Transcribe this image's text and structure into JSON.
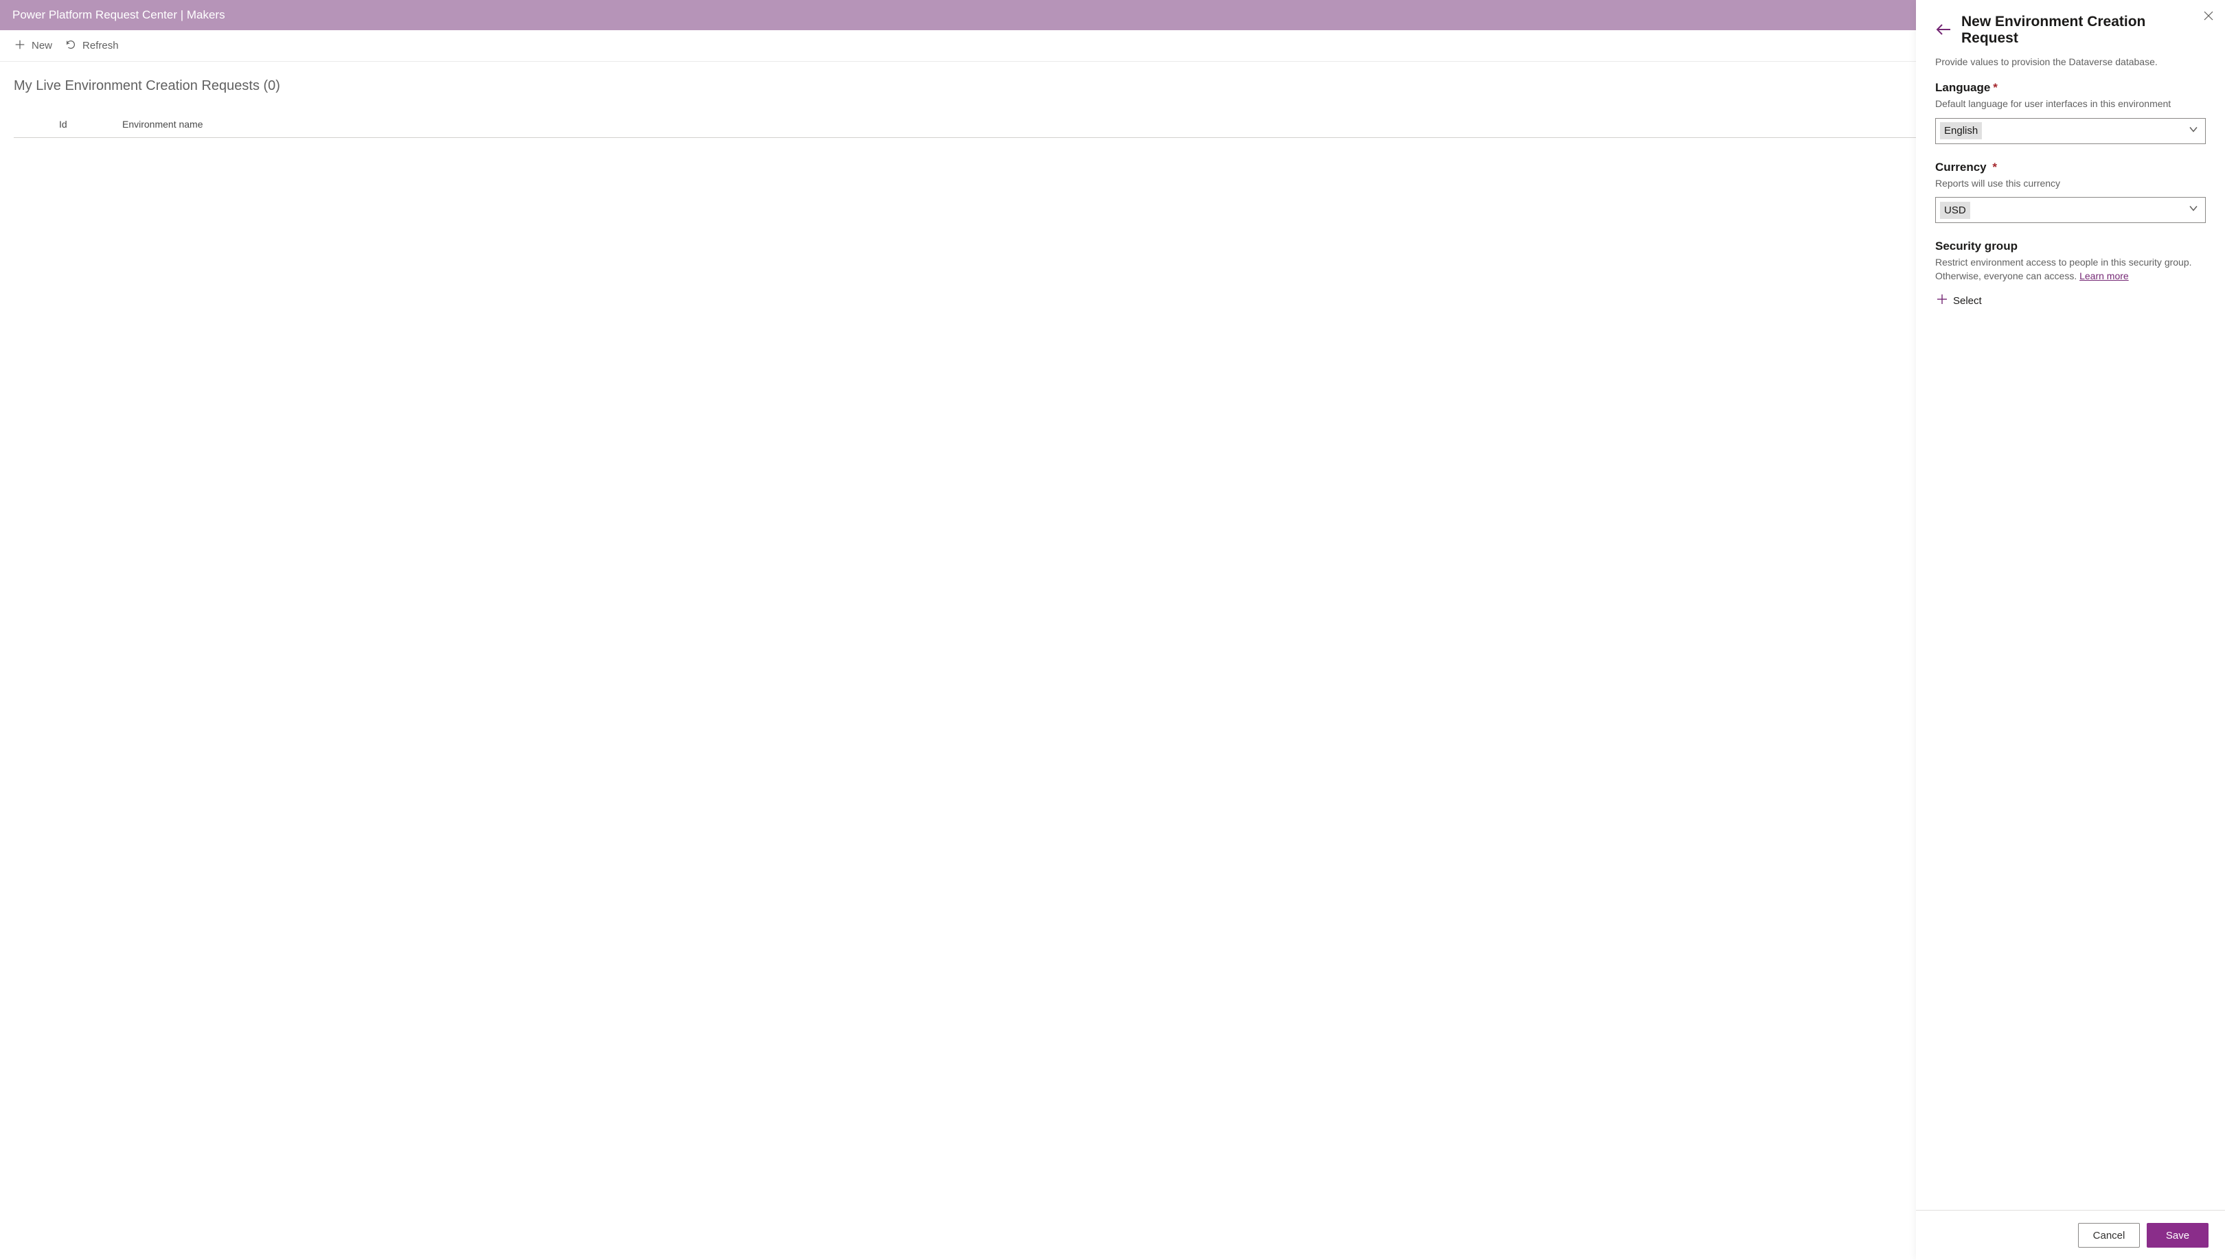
{
  "header": {
    "title": "Power Platform Request Center | Makers"
  },
  "commandBar": {
    "new_label": "New",
    "refresh_label": "Refresh"
  },
  "view": {
    "title": "My Live Environment Creation Requests (0)",
    "columns": {
      "id": "Id",
      "envname": "Environment name"
    }
  },
  "panel": {
    "title": "New Environment Creation Request",
    "subtitle": "Provide values to provision the Dataverse database.",
    "language": {
      "label": "Language",
      "hint": "Default language for user interfaces in this environment",
      "value": "English"
    },
    "currency": {
      "label": "Currency",
      "hint": "Reports will use this currency",
      "value": "USD"
    },
    "security": {
      "label": "Security group",
      "hint": "Restrict environment access to people in this security group. Otherwise, everyone can access. ",
      "learn_more": "Learn more",
      "select_label": "Select"
    },
    "footer": {
      "cancel": "Cancel",
      "save": "Save"
    }
  }
}
